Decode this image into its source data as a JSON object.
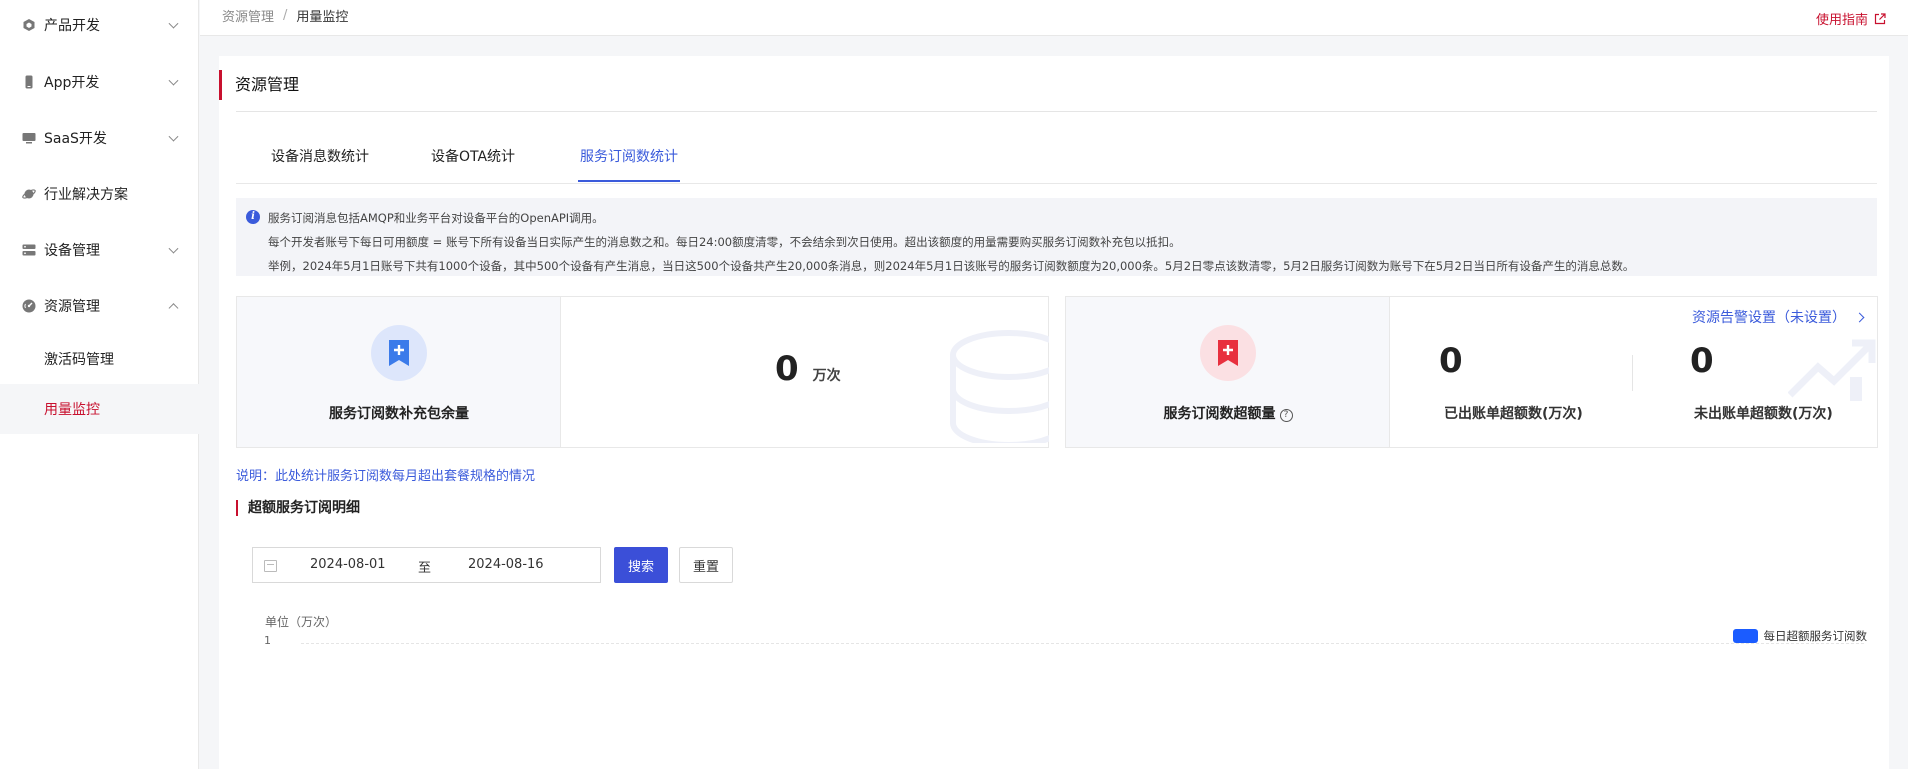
{
  "sidebar": {
    "items": [
      {
        "label": "产品开发",
        "icon": "cube-icon"
      },
      {
        "label": "App开发",
        "icon": "phone-icon"
      },
      {
        "label": "SaaS开发",
        "icon": "monitor-icon"
      },
      {
        "label": "行业解决方案",
        "icon": "planet-icon"
      },
      {
        "label": "设备管理",
        "icon": "server-icon"
      },
      {
        "label": "资源管理",
        "icon": "dashboard-icon"
      }
    ],
    "sub_items": [
      {
        "label": "激活码管理"
      },
      {
        "label": "用量监控"
      }
    ]
  },
  "topbar": {
    "breadcrumb_1": "资源管理",
    "breadcrumb_sep": "/",
    "breadcrumb_2": "用量监控",
    "guide_label": "使用指南"
  },
  "panel": {
    "title": "资源管理",
    "tabs": [
      {
        "label": "设备消息数统计"
      },
      {
        "label": "设备OTA统计"
      },
      {
        "label": "服务订阅数统计"
      }
    ],
    "notice": {
      "line1": "服务订阅消息包括AMQP和业务平台对设备平台的OpenAPI调用。",
      "line2": "每个开发者账号下每日可用额度 = 账号下所有设备当日实际产生的消息数之和。每日24:00额度清零，不会结余到次日使用。超出该额度的用量需要购买服务订阅数补充包以抵扣。",
      "line3": "举例，2024年5月1日账号下共有1000个设备，其中500个设备有产生消息，当日这500个设备共产生20,000条消息，则2024年5月1日该账号的服务订阅数额度为20,000条。5月2日零点该数清零，5月2日服务订阅数为账号下在5月2日当日所有设备产生的消息总数。"
    },
    "card_supplement": {
      "label": "服务订阅数补充包余量",
      "value": "0",
      "unit": "万次"
    },
    "card_excess": {
      "label": "服务订阅数超额量",
      "help": "?",
      "alert_link": "资源告警设置（未设置）",
      "billed_value": "0",
      "billed_label": "已出账单超额数(万次)",
      "unbilled_value": "0",
      "unbilled_label": "未出账单超额数(万次)"
    },
    "description": "说明：此处统计服务订阅数每月超出套餐规格的情况",
    "section_title": "超额服务订阅明细",
    "filter": {
      "start_date": "2024-08-01",
      "to_label": "至",
      "end_date": "2024-08-16",
      "search_label": "搜索",
      "reset_label": "重置"
    },
    "chart": {
      "unit_label": "单位（万次）",
      "y_tick": "1",
      "legend_label": "每日超额服务订阅数"
    }
  },
  "colors": {
    "accent_red": "#c8102e",
    "primary_blue": "#3b4fd8",
    "legend_blue": "#1b5cff"
  }
}
